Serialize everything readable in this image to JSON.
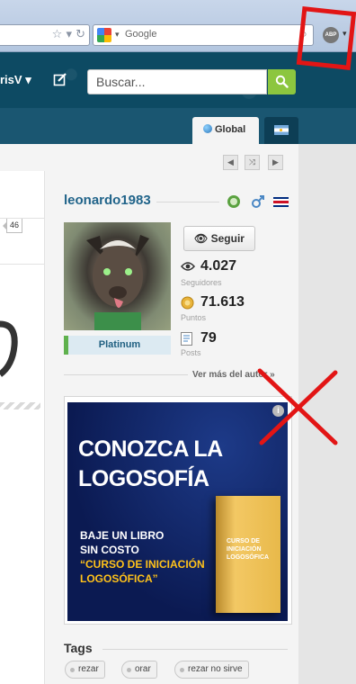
{
  "browser": {
    "search_placeholder": "Google",
    "abp_label": "ABP"
  },
  "site": {
    "username_menu": "risV",
    "search_placeholder": "Buscar...",
    "tabs": [
      {
        "label": "Global"
      }
    ]
  },
  "post": {
    "comments_count": "46"
  },
  "author": {
    "username": "leonardo1983",
    "rank": "Platinum",
    "follow_label": "Seguir",
    "stats": [
      {
        "value": "4.027",
        "label": "Seguidores",
        "icon": "eye-icon"
      },
      {
        "value": "71.613",
        "label": "Puntos",
        "icon": "coin-icon"
      },
      {
        "value": "79",
        "label": "Posts",
        "icon": "document-icon"
      }
    ],
    "more_link": "Ver más del autor »"
  },
  "ad": {
    "headline_1": "CONOZCA LA",
    "headline_2": "LOGOSOFÍA",
    "line_1": "BAJE UN LIBRO",
    "line_2": "SIN COSTO",
    "line_3": "“CURSO DE INICIACIÓN",
    "line_4": "LOGOSÓFICA”",
    "book_title_1": "CURSO DE",
    "book_title_2": "INICIACIÓN",
    "book_title_3": "LOGOSÓFICA",
    "info": "i"
  },
  "tags": {
    "title": "Tags",
    "items": [
      "rezar",
      "orar",
      "rezar no sirve"
    ]
  },
  "colors": {
    "header": "#0d4a63",
    "accent_green": "#8cc63f",
    "link_blue": "#21648a",
    "annotation_red": "#e21515"
  }
}
